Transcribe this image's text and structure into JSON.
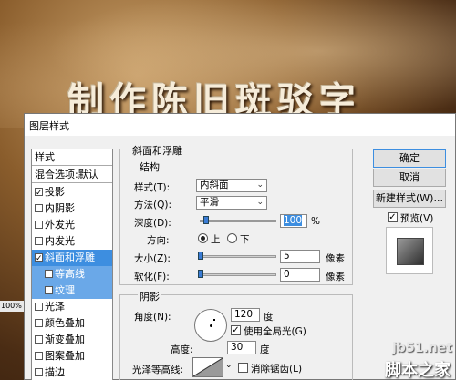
{
  "background": {
    "title_text": "制作陈旧斑驳字"
  },
  "zoom_label": "100%",
  "dialog": {
    "title": "图层样式",
    "style_list": {
      "header": "样式",
      "blend": "混合选项:默认",
      "items": [
        {
          "label": "投影",
          "checked": true
        },
        {
          "label": "内阴影",
          "checked": false
        },
        {
          "label": "外发光",
          "checked": false
        },
        {
          "label": "内发光",
          "checked": false
        },
        {
          "label": "斜面和浮雕",
          "checked": true,
          "selected": true
        },
        {
          "label": "等高线",
          "checked": false,
          "sub": true
        },
        {
          "label": "纹理",
          "checked": false,
          "sub": true
        },
        {
          "label": "光泽",
          "checked": false
        },
        {
          "label": "颜色叠加",
          "checked": false
        },
        {
          "label": "渐变叠加",
          "checked": false
        },
        {
          "label": "图案叠加",
          "checked": false
        },
        {
          "label": "描边",
          "checked": false
        }
      ]
    },
    "bevel": {
      "group_title": "斜面和浮雕",
      "structure_title": "结构",
      "style_label": "样式(T):",
      "style_value": "内斜面",
      "technique_label": "方法(Q):",
      "technique_value": "平滑",
      "depth_label": "深度(D):",
      "depth_value": "100",
      "depth_unit": "%",
      "direction_label": "方向:",
      "direction_up": "上",
      "direction_down": "下",
      "size_label": "大小(Z):",
      "size_value": "5",
      "size_unit": "像素",
      "soften_label": "软化(F):",
      "soften_value": "0",
      "soften_unit": "像素"
    },
    "shading": {
      "group_title": "阴影",
      "angle_label": "角度(N):",
      "angle_value": "120",
      "angle_unit": "度",
      "global_light_label": "使用全局光(G)",
      "altitude_label": "高度:",
      "altitude_value": "30",
      "altitude_unit": "度",
      "gloss_label": "光泽等高线:",
      "antialias_label": "消除锯齿(L)"
    },
    "buttons": {
      "ok": "确定",
      "cancel": "取消",
      "new_style": "新建样式(W)...",
      "preview": "预览(V)"
    }
  },
  "watermark": {
    "line1": "jb51.net",
    "line2": "脚本之家"
  }
}
